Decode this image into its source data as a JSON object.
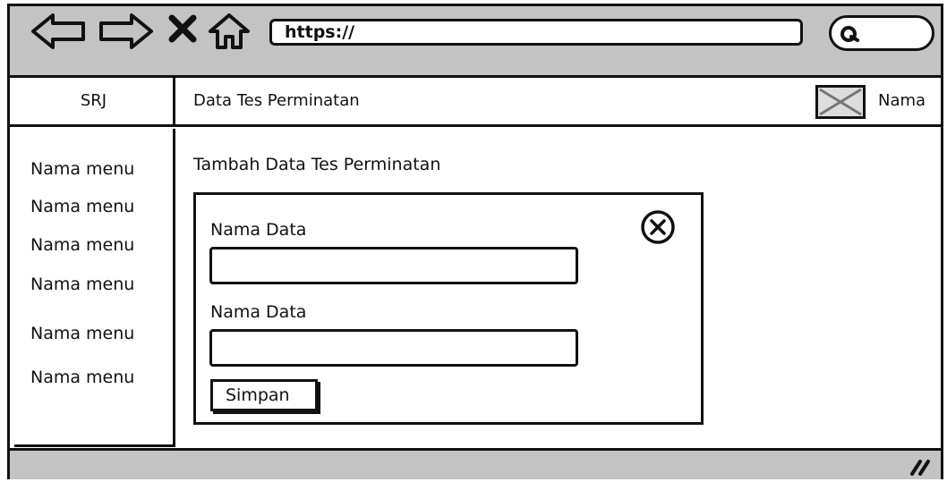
{
  "browser": {
    "url": "https://",
    "icons": [
      "back-arrow-icon",
      "forward-arrow-icon",
      "close-x-icon",
      "home-icon",
      "search-icon"
    ]
  },
  "header": {
    "brand": "SRJ",
    "title": "Data Tes Perminatan",
    "user_name": "Nama"
  },
  "sidebar": {
    "items": [
      "Nama menu",
      "Nama menu",
      "Nama menu",
      "Nama menu",
      "Nama menu",
      "Nama menu"
    ]
  },
  "main": {
    "title": "Tambah Data Tes Perminatan",
    "form": {
      "fields": [
        {
          "label": "Nama Data",
          "value": ""
        },
        {
          "label": "Nama Data",
          "value": ""
        }
      ],
      "submit_label": "Simpan"
    }
  },
  "statusbar": {
    "resize_icon": "resize-grip-icon"
  }
}
